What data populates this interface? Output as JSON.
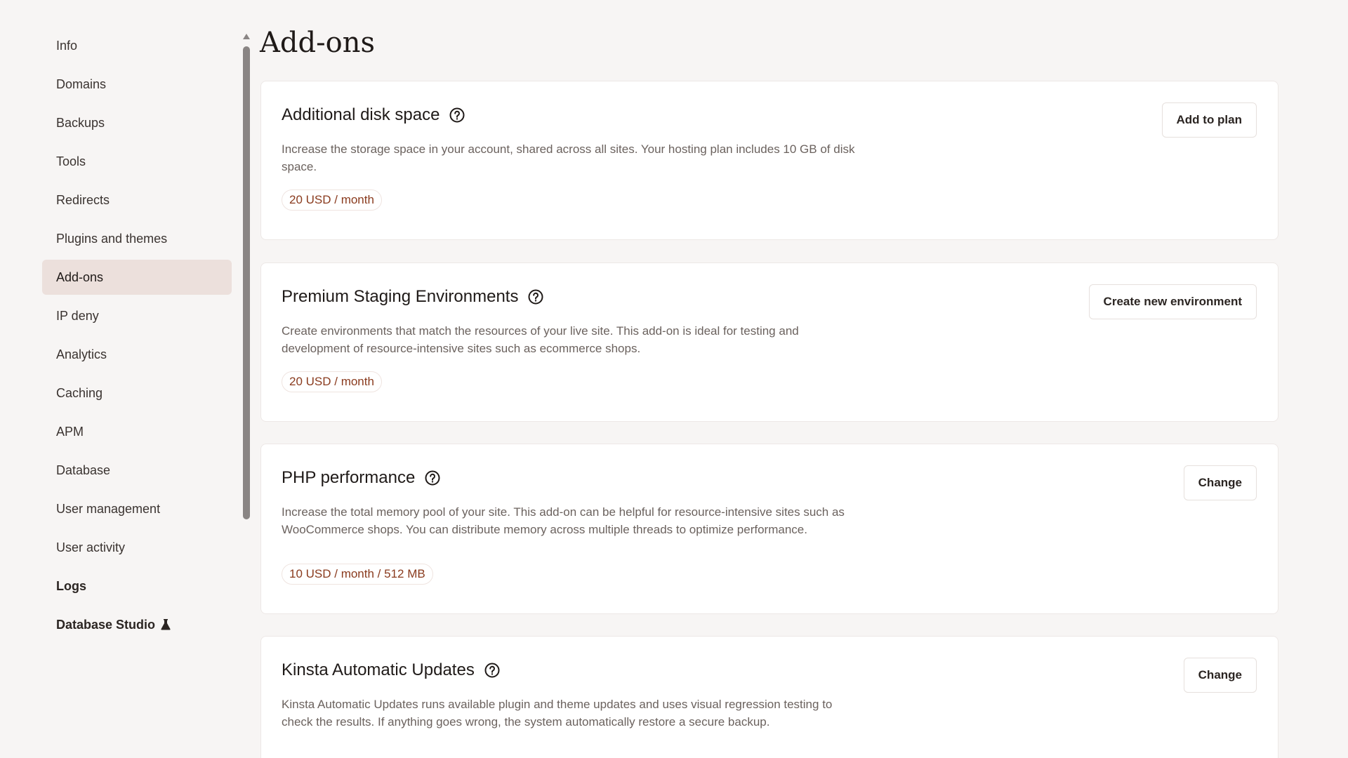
{
  "sidebar": {
    "items": [
      {
        "label": "Info"
      },
      {
        "label": "Domains"
      },
      {
        "label": "Backups"
      },
      {
        "label": "Tools"
      },
      {
        "label": "Redirects"
      },
      {
        "label": "Plugins and themes"
      },
      {
        "label": "Add-ons",
        "active": true
      },
      {
        "label": "IP deny"
      },
      {
        "label": "Analytics"
      },
      {
        "label": "Caching"
      },
      {
        "label": "APM"
      },
      {
        "label": "Database"
      },
      {
        "label": "User management"
      },
      {
        "label": "User activity"
      },
      {
        "label": "Logs"
      },
      {
        "label": "Database Studio",
        "icon": "flask-icon"
      }
    ]
  },
  "page": {
    "title": "Add-ons"
  },
  "addons": [
    {
      "title": "Additional disk space",
      "description": "Increase the storage space in your account, shared across all sites. Your hosting plan includes 10 GB of disk space.",
      "price": "20 USD / month",
      "button": "Add to plan"
    },
    {
      "title": "Premium Staging Environments",
      "description": "Create environments that match the resources of your live site. This add-on is ideal for testing and development of resource-intensive sites such as ecommerce shops.",
      "price": "20 USD / month",
      "button": "Create new environment"
    },
    {
      "title": "PHP performance",
      "description": "Increase the total memory pool of your site. This add-on can be helpful for resource-intensive sites such as WooCommerce shops. You can distribute memory across multiple threads to optimize performance.",
      "price": "10 USD / month / 512 MB",
      "button": "Change"
    },
    {
      "title": "Kinsta Automatic Updates",
      "description": "Kinsta Automatic Updates runs available plugin and theme updates and uses visual regression testing to check the results. If anything goes wrong, the system automatically restore a secure backup.",
      "button": "Change"
    }
  ],
  "colors": {
    "background": "#f7f5f4",
    "active_nav": "#ece0dc",
    "price_text": "#8a3b1e"
  }
}
